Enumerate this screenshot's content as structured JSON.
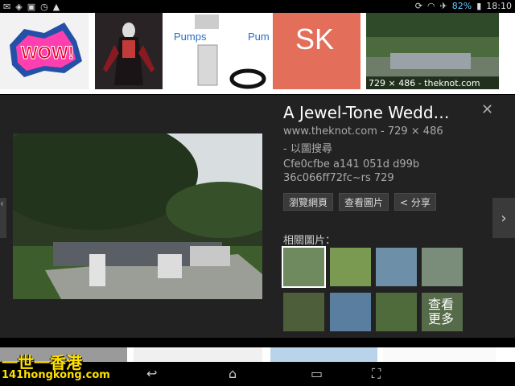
{
  "status": {
    "battery": "82%",
    "time": "18:10"
  },
  "thumbnail_strip": {
    "items": [
      {
        "alt": "WOW!"
      },
      {
        "alt": "dark figure"
      },
      {
        "alt": "Pumps"
      },
      {
        "alt": "SK"
      },
      {
        "alt": "wedding",
        "caption": "729 × 486 - theknot.com"
      }
    ],
    "pumps_text": "Pumps",
    "sk_text": "SK",
    "wow_text": "WOW!"
  },
  "detail": {
    "title": "A Jewel-Tone Wedd…",
    "source": "www.theknot.com - 729 × 486",
    "search_by_image": "- 以圖搜尋",
    "hash_line1": "Cfe0cfbe a141 051d d99b",
    "hash_line2": "36c066ff72fc~rs 729",
    "buttons": {
      "visit": "瀏覽網頁",
      "view": "查看圖片",
      "share": "< 分享"
    },
    "related_label": "相關圖片：",
    "more_label_1": "查看",
    "more_label_2": "更多"
  },
  "watermark": {
    "line1": "一世一香港",
    "line2": "141hongkong.com"
  },
  "colors": {
    "panel_bg": "#222222",
    "sk_bg": "#e36e5a",
    "watermark": "#ffe000"
  }
}
